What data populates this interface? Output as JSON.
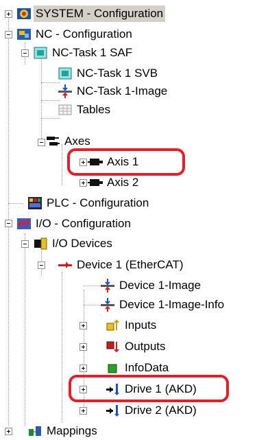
{
  "tree": {
    "system": "SYSTEM - Configuration",
    "nc": "NC - Configuration",
    "nc_task_saf": "NC-Task 1 SAF",
    "nc_task_svb": "NC-Task 1 SVB",
    "nc_task_image": "NC-Task 1-Image",
    "tables": "Tables",
    "axes": "Axes",
    "axis1": "Axis 1",
    "axis2": "Axis 2",
    "plc": "PLC - Configuration",
    "io": "I/O - Configuration",
    "io_devices": "I/O Devices",
    "device1": "Device 1 (EtherCAT)",
    "device1_image": "Device 1-Image",
    "device1_image_info": "Device 1-Image-Info",
    "inputs": "Inputs",
    "outputs": "Outputs",
    "infodata": "InfoData",
    "drive1": "Drive 1 (AKD)",
    "drive2": "Drive 2 (AKD)",
    "mappings": "Mappings"
  },
  "highlights": [
    "axis1",
    "drive1"
  ],
  "colors": {
    "highlight_ring": "#e3202a",
    "selection_bg": "#d4d0c8"
  }
}
